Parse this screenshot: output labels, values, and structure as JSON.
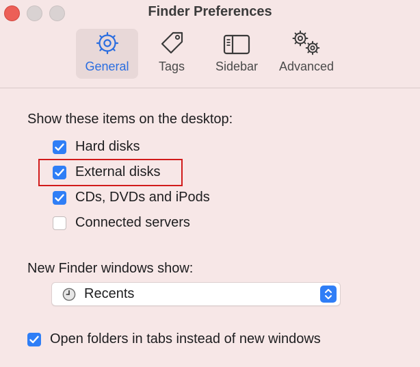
{
  "window": {
    "title": "Finder Preferences"
  },
  "toolbar": {
    "tabs": [
      {
        "label": "General",
        "icon": "gear-icon",
        "selected": true
      },
      {
        "label": "Tags",
        "icon": "tag-icon",
        "selected": false
      },
      {
        "label": "Sidebar",
        "icon": "sidebar-icon",
        "selected": false
      },
      {
        "label": "Advanced",
        "icon": "gears-icon",
        "selected": false
      }
    ]
  },
  "desktop_items": {
    "heading": "Show these items on the desktop:",
    "items": [
      {
        "label": "Hard disks",
        "checked": true
      },
      {
        "label": "External disks",
        "checked": true,
        "highlighted": true
      },
      {
        "label": "CDs, DVDs and iPods",
        "checked": true
      },
      {
        "label": "Connected servers",
        "checked": false
      }
    ]
  },
  "new_window": {
    "heading": "New Finder windows show:",
    "selected": "Recents",
    "icon": "clock-icon"
  },
  "open_in_tabs": {
    "label": "Open folders in tabs instead of new windows",
    "checked": true
  },
  "colors": {
    "accent": "#2f7ef6",
    "background": "#f7e7e7",
    "highlight": "#d11b1b",
    "close_button": "#ec5f57"
  }
}
